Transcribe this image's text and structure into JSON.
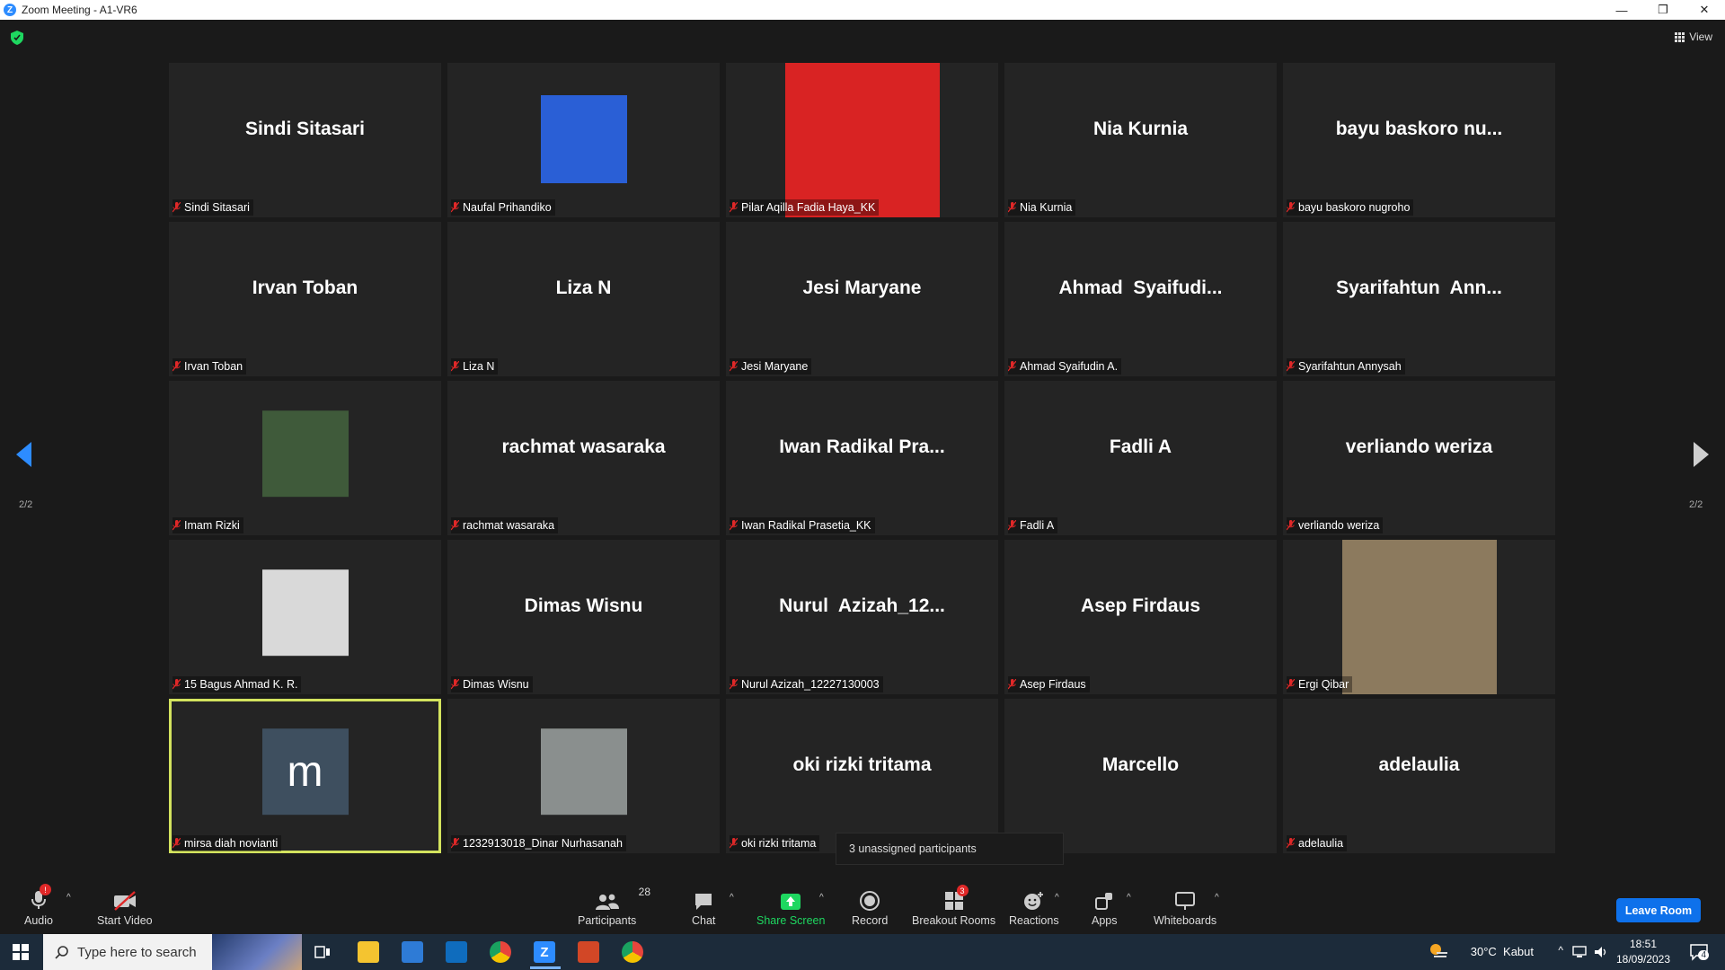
{
  "window": {
    "title": "Zoom Meeting - A1-VR6",
    "min": "—",
    "restore": "❐",
    "close": "✕"
  },
  "topbar": {
    "view_label": "View"
  },
  "pager": {
    "left": "2/2",
    "right": "2/2"
  },
  "participants": [
    {
      "display": "Sindi Sitasari",
      "label": "Sindi Sitasari",
      "media": "none"
    },
    {
      "display": "",
      "label": "Naufal Prihandiko",
      "media": "photo",
      "photo_color": "#2a5fd6"
    },
    {
      "display": "",
      "label": "Pilar Aqilla Fadia Haya_KK",
      "media": "photo",
      "photo_color": "#d92323"
    },
    {
      "display": "Nia Kurnia",
      "label": "Nia Kurnia",
      "media": "none"
    },
    {
      "display": "bayu baskoro nu...",
      "label": "bayu baskoro nugroho",
      "media": "none"
    },
    {
      "display": "Irvan Toban",
      "label": "Irvan Toban",
      "media": "none"
    },
    {
      "display": "Liza N",
      "label": "Liza N",
      "media": "none"
    },
    {
      "display": "Jesi Maryane",
      "label": "Jesi Maryane",
      "media": "none"
    },
    {
      "display": "Ahmad  Syaifudi...",
      "label": "Ahmad Syaifudin A.",
      "media": "none"
    },
    {
      "display": "Syarifahtun  Ann...",
      "label": "Syarifahtun Annysah",
      "media": "none"
    },
    {
      "display": "",
      "label": "Imam Rizki",
      "media": "avatar",
      "photo_color": "#3f5a3a"
    },
    {
      "display": "rachmat wasaraka",
      "label": "rachmat wasaraka",
      "media": "none"
    },
    {
      "display": "Iwan Radikal Pra...",
      "label": "Iwan Radikal Prasetia_KK",
      "media": "none"
    },
    {
      "display": "Fadli A",
      "label": "Fadli A",
      "media": "none"
    },
    {
      "display": "verliando weriza",
      "label": "verliando weriza",
      "media": "none"
    },
    {
      "display": "",
      "label": "15 Bagus Ahmad K. R.",
      "media": "avatar",
      "photo_color": "#d9d9d9"
    },
    {
      "display": "Dimas Wisnu",
      "label": "Dimas Wisnu",
      "media": "none"
    },
    {
      "display": "Nurul  Azizah_12...",
      "label": "Nurul Azizah_12227130003",
      "media": "none"
    },
    {
      "display": "Asep Firdaus",
      "label": "Asep Firdaus",
      "media": "none"
    },
    {
      "display": "",
      "label": "Ergi Qibar",
      "media": "photo",
      "photo_color": "#8c7a5e"
    },
    {
      "display": "",
      "label": "mirsa diah novianti",
      "media": "letter",
      "letter": "m",
      "photo_color": "#3e4f5f",
      "active": true
    },
    {
      "display": "",
      "label": "1232913018_Dinar Nurhasanah",
      "media": "avatar",
      "photo_color": "#8a8f8e"
    },
    {
      "display": "oki rizki tritama",
      "label": "oki rizki tritama",
      "media": "none"
    },
    {
      "display": "Marcello",
      "label": "o",
      "media": "none"
    },
    {
      "display": "adelaulia",
      "label": "adelaulia",
      "media": "none"
    }
  ],
  "tooltip": {
    "text": "3 unassigned participants"
  },
  "toolbar": {
    "audio": "Audio",
    "start_video": "Start Video",
    "participants": "Participants",
    "participants_count": "28",
    "chat": "Chat",
    "share_screen": "Share Screen",
    "record": "Record",
    "breakout_rooms": "Breakout Rooms",
    "breakout_badge": "3",
    "reactions": "Reactions",
    "apps": "Apps",
    "whiteboards": "Whiteboards",
    "leave": "Leave Room",
    "audio_badge": "!"
  },
  "taskbar": {
    "search_placeholder": "Type here to search",
    "weather": "30°C  Kabut",
    "time": "18:51",
    "date": "18/09/2023",
    "notifications": "4"
  },
  "colors": {
    "accent": "#0e71eb",
    "active_border": "#d3e35e",
    "share_green": "#1ed760",
    "muted_red": "#e02828"
  }
}
